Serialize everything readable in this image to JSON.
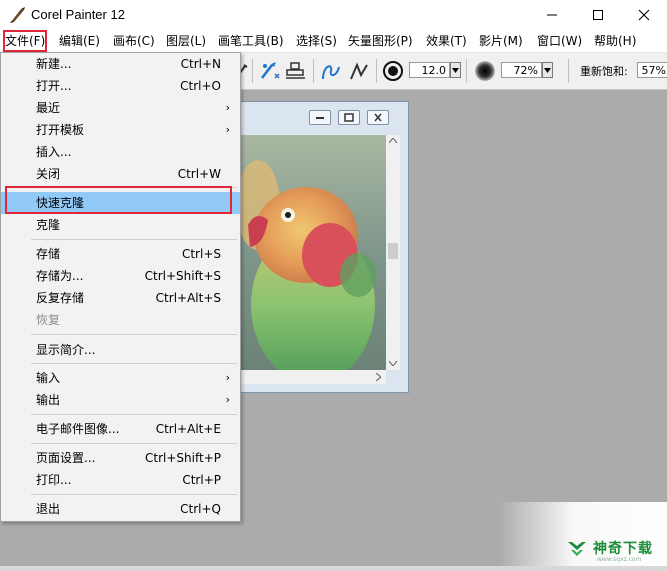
{
  "window": {
    "title": "Corel Painter 12"
  },
  "menubar": [
    "文件(F)",
    "编辑(E)",
    "画布(C)",
    "图层(L)",
    "画笔工具(B)",
    "选择(S)",
    "矢量图形(P)",
    "效果(T)",
    "影片(M)",
    "窗口(W)",
    "帮助(H)"
  ],
  "toolbar": {
    "size_value": "12.0",
    "opacity_value": "72%",
    "resaturation_label": "重新饱和:",
    "resaturation_value": "57%"
  },
  "file_menu": {
    "new": {
      "label": "新建...",
      "shortcut": "Ctrl+N"
    },
    "open": {
      "label": "打开...",
      "shortcut": "Ctrl+O"
    },
    "recent": {
      "label": "最近"
    },
    "open_template": {
      "label": "打开模板"
    },
    "place": {
      "label": "插入..."
    },
    "close": {
      "label": "关闭",
      "shortcut": "Ctrl+W"
    },
    "quick_clone": {
      "label": "快速克隆"
    },
    "clone": {
      "label": "克隆"
    },
    "save": {
      "label": "存储",
      "shortcut": "Ctrl+S"
    },
    "save_as": {
      "label": "存储为...",
      "shortcut": "Ctrl+Shift+S"
    },
    "iterative_save": {
      "label": "反复存储",
      "shortcut": "Ctrl+Alt+S"
    },
    "revert": {
      "label": "恢复"
    },
    "get_info": {
      "label": "显示简介..."
    },
    "import": {
      "label": "输入"
    },
    "export": {
      "label": "输出"
    },
    "email_image": {
      "label": "电子邮件图像...",
      "shortcut": "Ctrl+Alt+E"
    },
    "page_setup": {
      "label": "页面设置...",
      "shortcut": "Ctrl+Shift+P"
    },
    "print": {
      "label": "打印...",
      "shortcut": "Ctrl+P"
    },
    "exit": {
      "label": "退出",
      "shortcut": "Ctrl+Q"
    }
  },
  "watermark": {
    "text": "神奇下载",
    "sub": "www.sqxz.com"
  },
  "colors": {
    "highlight": "#91c9f7",
    "annotation_red": "#e0263a"
  }
}
